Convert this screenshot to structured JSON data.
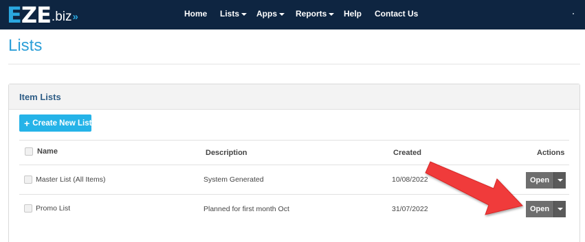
{
  "navbar": {
    "logo": {
      "part1": "EZE",
      "part2": ".biz",
      "arrows": "»"
    },
    "items": [
      {
        "label": "Home",
        "dropdown": false
      },
      {
        "label": "Lists",
        "dropdown": true
      },
      {
        "label": "Apps",
        "dropdown": true
      },
      {
        "label": "Reports",
        "dropdown": true
      },
      {
        "label": "Help",
        "dropdown": false
      },
      {
        "label": "Contact Us",
        "dropdown": false
      }
    ]
  },
  "page": {
    "title": "Lists"
  },
  "panel": {
    "title": "Item Lists",
    "create_button": {
      "icon": "+",
      "label": "Create New List"
    }
  },
  "table": {
    "columns": [
      "Name",
      "Description",
      "Created",
      "Actions"
    ],
    "rows": [
      {
        "name": "Master List (All Items)",
        "description": "System Generated",
        "created": "10/08/2022",
        "action": "Open"
      },
      {
        "name": "Promo List",
        "description": "Planned for first month Oct",
        "created": "31/07/2022",
        "action": "Open"
      }
    ]
  },
  "colors": {
    "navbar_bg": "#0e2541",
    "brand_accent": "#2aa8e0",
    "title_color": "#2c9fd8",
    "create_button_bg": "#25b3e8",
    "open_button_bg": "#6e6e6e",
    "annotation_arrow": "#f03a3a"
  },
  "icons": {
    "create": "plus-icon",
    "dropdown": "caret-down-icon",
    "annotation": "red-arrow-icon"
  }
}
